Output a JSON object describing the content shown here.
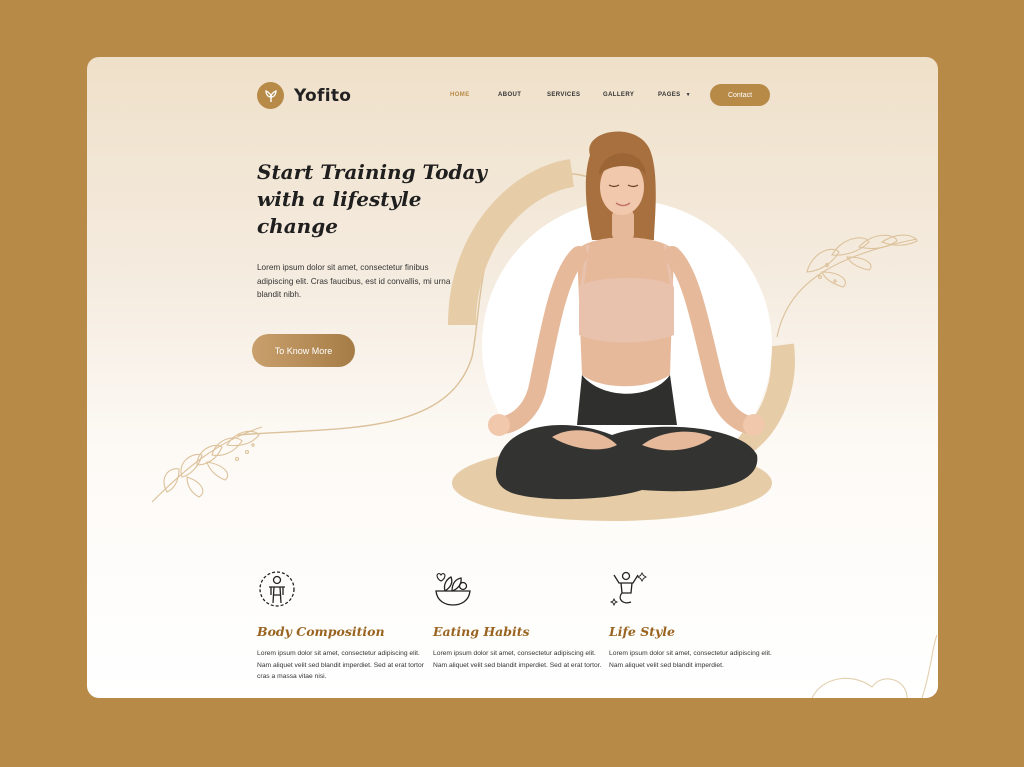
{
  "brand": {
    "name": "Yofito",
    "logo_icon": "lotus-icon"
  },
  "nav": {
    "items": [
      {
        "label": "HOME",
        "active": true
      },
      {
        "label": "ABOUT",
        "active": false
      },
      {
        "label": "SERVICES",
        "active": false
      },
      {
        "label": "GALLERY",
        "active": false
      },
      {
        "label": "PAGES",
        "active": false,
        "has_dropdown": true
      }
    ],
    "contact_label": "Contact"
  },
  "hero": {
    "title_lines": [
      "Start Training Today",
      "with a lifestyle",
      "change"
    ],
    "text": "Lorem ipsum dolor sit amet, consectetur finibus adipiscing elit. Cras faucibus, est id convallis, mi urna blandit nibh.",
    "button_label": "To Know More",
    "image": "woman-meditating-lotus-pose"
  },
  "features": [
    {
      "icon": "body-composition-icon",
      "title": "Body Composition",
      "text": "Lorem ipsum dolor sit amet, consectetur adipiscing elit. Nam aliquet velit sed blandit imperdiet. Sed at erat tortor cras a massa vitae nisi."
    },
    {
      "icon": "salad-bowl-icon",
      "title": "Eating Habits",
      "text": "Lorem ipsum dolor sit amet, consectetur adipiscing elit. Nam aliquet velit sed blandit imperdiet. Sed at erat tortor."
    },
    {
      "icon": "lifestyle-figure-icon",
      "title": "Life Style",
      "text": "Lorem ipsum dolor sit amet, consectetur adipiscing elit. Nam aliquet velit sed blandit imperdiet."
    }
  ],
  "colors": {
    "accent": "#b78a48",
    "page_bg": "#b78a48",
    "title_brown": "#9a6420",
    "dark": "#1f1f1f"
  }
}
